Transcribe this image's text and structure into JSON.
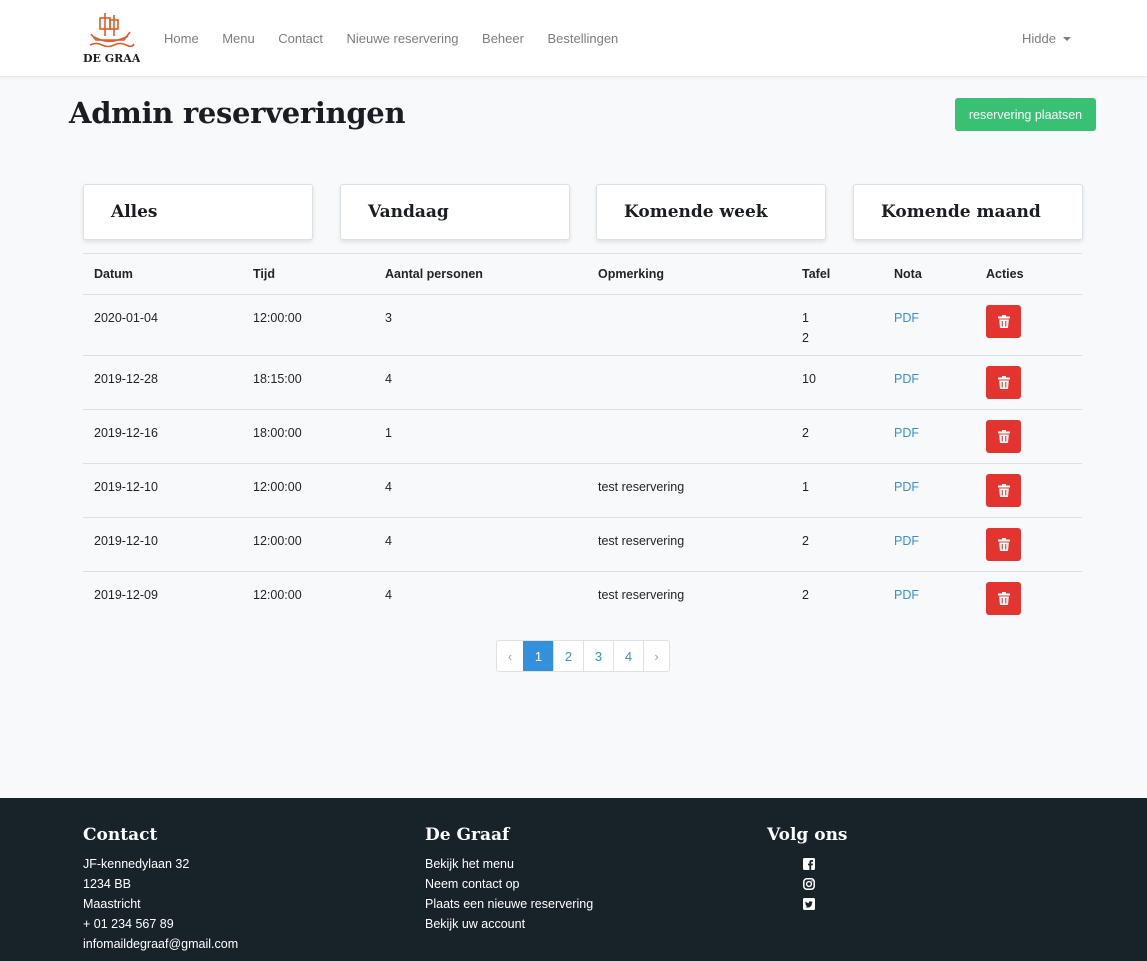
{
  "nav": {
    "logo_text": "DE GRAAF",
    "links": [
      "Home",
      "Menu",
      "Contact",
      "Nieuwe reservering",
      "Beheer",
      "Bestellingen"
    ],
    "user": "Hidde"
  },
  "page": {
    "title": "Admin reserveringen",
    "new_button": "reservering plaatsen"
  },
  "filters": [
    "Alles",
    "Vandaag",
    "Komende week",
    "Komende maand"
  ],
  "table": {
    "headers": [
      "Datum",
      "Tijd",
      "Aantal personen",
      "Opmerking",
      "Tafel",
      "Nota",
      "Acties"
    ],
    "rows": [
      {
        "date": "2020-01-04",
        "time": "12:00:00",
        "persons": "3",
        "remark": "",
        "tables": [
          "1",
          "2"
        ],
        "nota": "PDF"
      },
      {
        "date": "2019-12-28",
        "time": "18:15:00",
        "persons": "4",
        "remark": "",
        "tables": [
          "10"
        ],
        "nota": "PDF"
      },
      {
        "date": "2019-12-16",
        "time": "18:00:00",
        "persons": "1",
        "remark": "",
        "tables": [
          "2"
        ],
        "nota": "PDF"
      },
      {
        "date": "2019-12-10",
        "time": "12:00:00",
        "persons": "4",
        "remark": "test reservering",
        "tables": [
          "1"
        ],
        "nota": "PDF"
      },
      {
        "date": "2019-12-10",
        "time": "12:00:00",
        "persons": "4",
        "remark": "test reservering",
        "tables": [
          "2"
        ],
        "nota": "PDF"
      },
      {
        "date": "2019-12-09",
        "time": "12:00:00",
        "persons": "4",
        "remark": "test reservering",
        "tables": [
          "2"
        ],
        "nota": "PDF"
      }
    ]
  },
  "pagination": {
    "prev": "‹",
    "pages": [
      "1",
      "2",
      "3",
      "4"
    ],
    "active": "1",
    "next": "›"
  },
  "footer": {
    "contact": {
      "title": "Contact",
      "lines": [
        "JF-kennedylaan 32",
        "1234 BB",
        "Maastricht",
        "+ 01 234 567 89",
        "infomaildegraaf@gmail.com"
      ]
    },
    "about": {
      "title": "De Graaf",
      "links": [
        "Bekijk het menu",
        "Neem contact op",
        "Plaats een nieuwe reservering",
        "Bekijk uw account"
      ]
    },
    "social": {
      "title": "Volg ons",
      "icons": [
        "facebook-icon",
        "instagram-icon",
        "twitter-icon"
      ]
    }
  },
  "colors": {
    "brand_orange": "#e35a2a",
    "success": "#38c172",
    "danger": "#e3342f",
    "link": "#3490dc",
    "footer_bg": "#182229"
  }
}
